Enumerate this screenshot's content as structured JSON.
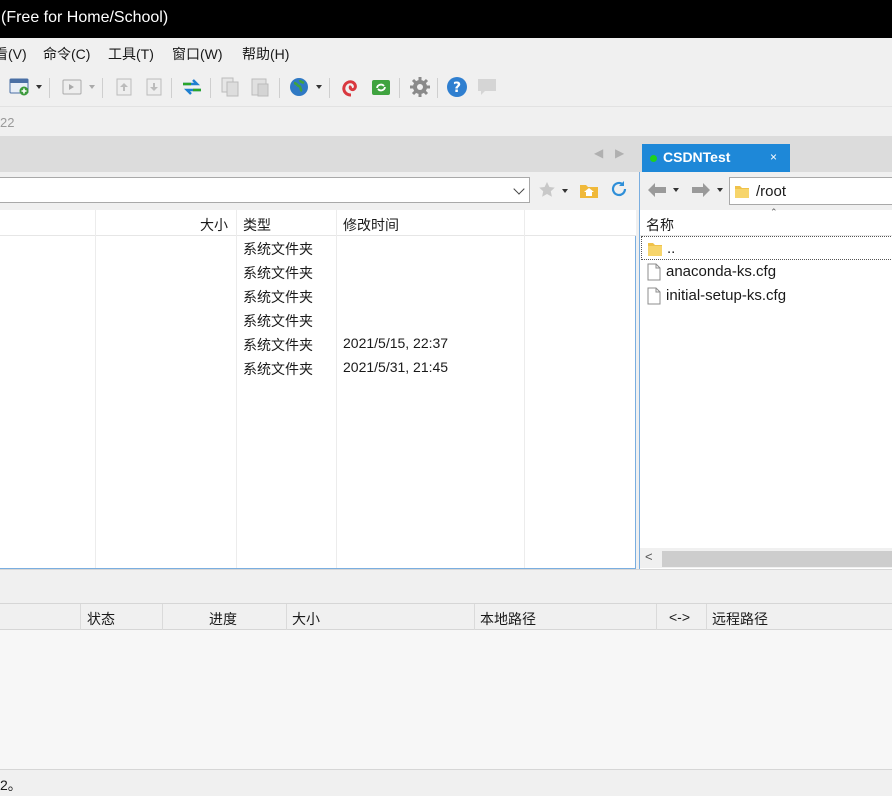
{
  "window": {
    "title": "(Free for Home/School)"
  },
  "menu": [
    {
      "label": "看(V)"
    },
    {
      "label": "命令(C)"
    },
    {
      "label": "工具(T)"
    },
    {
      "label": "窗口(W)"
    },
    {
      "label": "帮助(H)"
    }
  ],
  "toolbar": {
    "icons": [
      "new-session-icon",
      "terminal-icon",
      "upload-icon",
      "download-icon",
      "transfer-icon",
      "copy-icon",
      "paste-icon",
      "globe-icon",
      "spiral-icon",
      "sync-icon",
      "settings-icon",
      "help-icon",
      "chat-icon"
    ]
  },
  "session_strip": {
    "text": "22"
  },
  "tabs": [
    {
      "label": "CSDNTest",
      "status_color": "#1fd11f",
      "close": "×"
    }
  ],
  "local": {
    "columns": {
      "size": "大小",
      "type": "类型",
      "modified": "修改时间"
    },
    "rows": [
      {
        "type": "系统文件夹",
        "modified": ""
      },
      {
        "type": "系统文件夹",
        "modified": ""
      },
      {
        "type": "系统文件夹",
        "modified": ""
      },
      {
        "type": "系统文件夹",
        "modified": ""
      },
      {
        "type": "系统文件夹",
        "modified": "2021/5/15, 22:37"
      },
      {
        "type": "系统文件夹",
        "modified": "2021/5/31, 21:45"
      }
    ]
  },
  "remote": {
    "path": "/root",
    "columns": {
      "name": "名称"
    },
    "files": [
      {
        "name": "..",
        "icon": "folder-icon"
      },
      {
        "name": "anaconda-ks.cfg",
        "icon": "file-icon"
      },
      {
        "name": "initial-setup-ks.cfg",
        "icon": "file-icon"
      }
    ]
  },
  "queue": {
    "columns": {
      "status": "状态",
      "progress": "进度",
      "size": "大小",
      "local_path": "本地路径",
      "direction": "<->",
      "remote_path": "远程路径"
    }
  },
  "status_bar": {
    "text": "2。"
  },
  "colors": {
    "tab_active": "#1e88d8",
    "pane_border": "#7aaee0",
    "title_bar": "#000000"
  }
}
